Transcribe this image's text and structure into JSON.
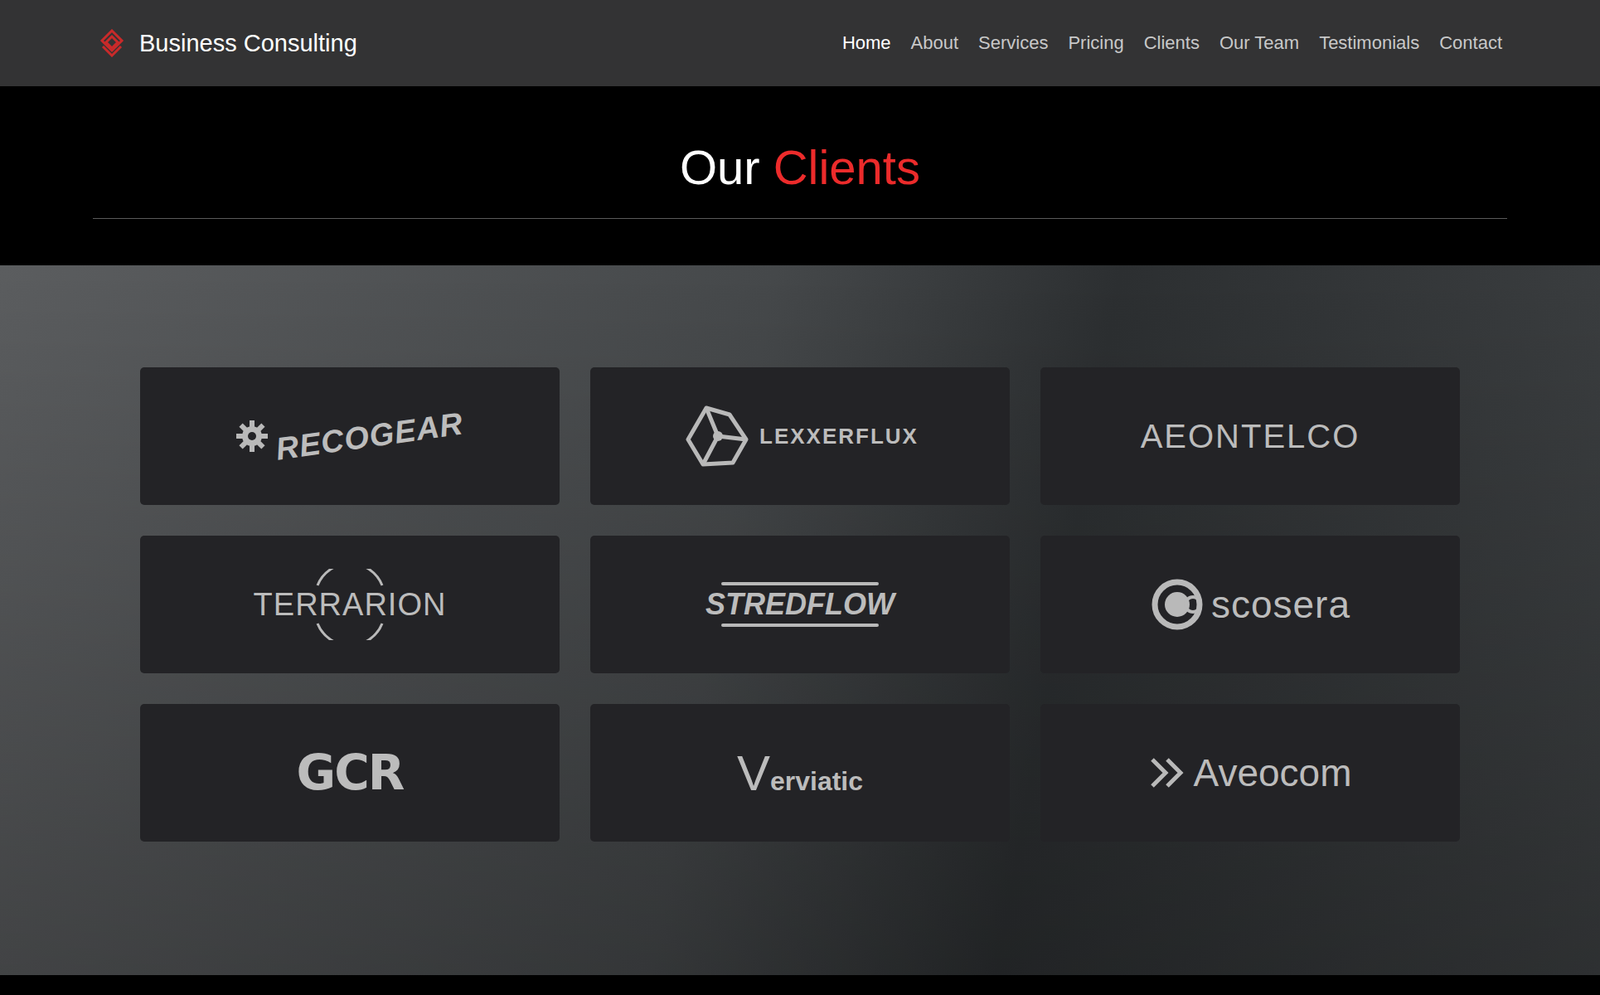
{
  "header": {
    "brand": "Business Consulting",
    "nav": [
      {
        "label": "Home",
        "selected": true
      },
      {
        "label": "About",
        "selected": false
      },
      {
        "label": "Services",
        "selected": false
      },
      {
        "label": "Pricing",
        "selected": false
      },
      {
        "label": "Clients",
        "selected": false
      },
      {
        "label": "Our Team",
        "selected": false
      },
      {
        "label": "Testimonials",
        "selected": false
      },
      {
        "label": "Contact",
        "selected": false
      }
    ]
  },
  "section": {
    "title": "Our",
    "title_accent": "Clients"
  },
  "clients": [
    {
      "name": "RECOGEAR",
      "kind": "gear"
    },
    {
      "name": "LEXXERFLUX",
      "kind": "hex"
    },
    {
      "name": "AEONTELCO",
      "kind": "plain"
    },
    {
      "name": "TERRARION",
      "kind": "ring"
    },
    {
      "name": "STREDFLOW",
      "kind": "underline"
    },
    {
      "name": "scosera",
      "kind": "target"
    },
    {
      "name": "GCR",
      "kind": "block"
    },
    {
      "name": "Verviatic",
      "kind": "initial"
    },
    {
      "name": "Aveocom",
      "kind": "chevrons"
    }
  ]
}
